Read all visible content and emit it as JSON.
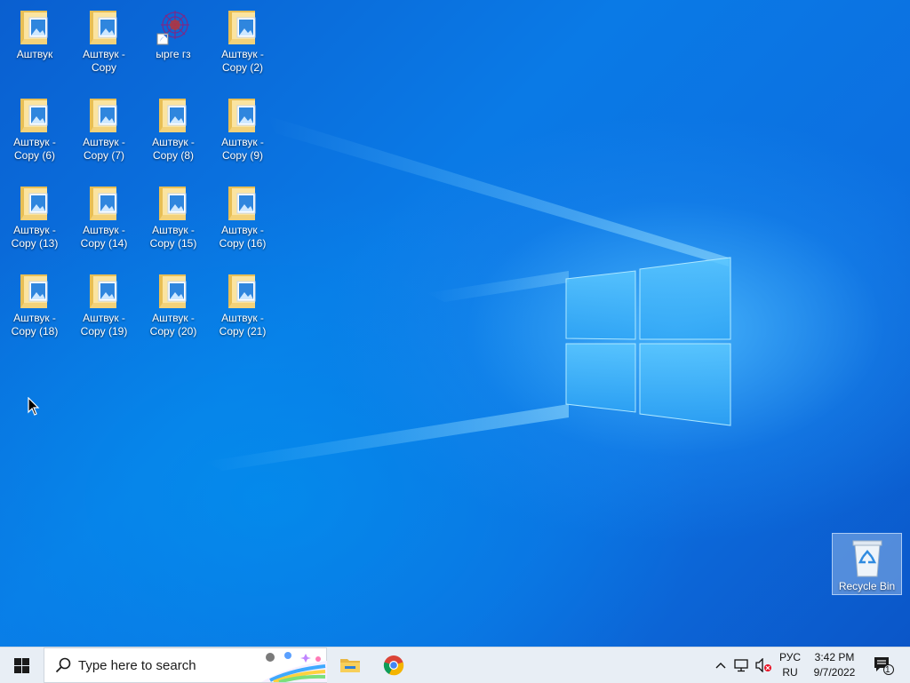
{
  "desktop": {
    "icons": [
      {
        "label": "Аштвук"
      },
      {
        "label": "Аштвук - Copy (6)"
      },
      {
        "label": "Аштвук - Copy (13)"
      },
      {
        "label": "Аштвук - Copy (18)"
      },
      {
        "label": "Аштвук - Copy"
      },
      {
        "label": "Аштвук - Copy (7)"
      },
      {
        "label": "Аштвук - Copy (14)"
      },
      {
        "label": "Аштвук - Copy (19)"
      },
      {
        "label": "ырге гз"
      },
      {
        "label": "Аштвук - Copy (8)"
      },
      {
        "label": "Аштвук - Copy (15)"
      },
      {
        "label": "Аштвук - Copy (20)"
      },
      {
        "label": "Аштвук - Copy (2)"
      },
      {
        "label": "Аштвук - Copy (9)"
      },
      {
        "label": "Аштвук - Copy (16)"
      },
      {
        "label": "Аштвук - Copy (21)"
      }
    ],
    "recycle_bin": {
      "label": "Recycle Bin",
      "icon": "recycle-bin-icon"
    }
  },
  "taskbar": {
    "start_icon": "windows-logo-icon",
    "search": {
      "placeholder": "Type here to search",
      "icon": "search-icon"
    },
    "apps": [
      {
        "name": "file-explorer",
        "icon": "folder-icon"
      },
      {
        "name": "chrome",
        "icon": "chrome-icon"
      }
    ],
    "tray": {
      "language_line1": "РУС",
      "language_line2": "RU",
      "time": "3:42 PM",
      "date": "9/7/2022",
      "notification_count": "1"
    }
  },
  "colors": {
    "desktop_blue": "#0a6fd8",
    "taskbar": "#e8eef5",
    "folder_yellow": "#f3d27a",
    "windows_blue": "#0078d7"
  }
}
